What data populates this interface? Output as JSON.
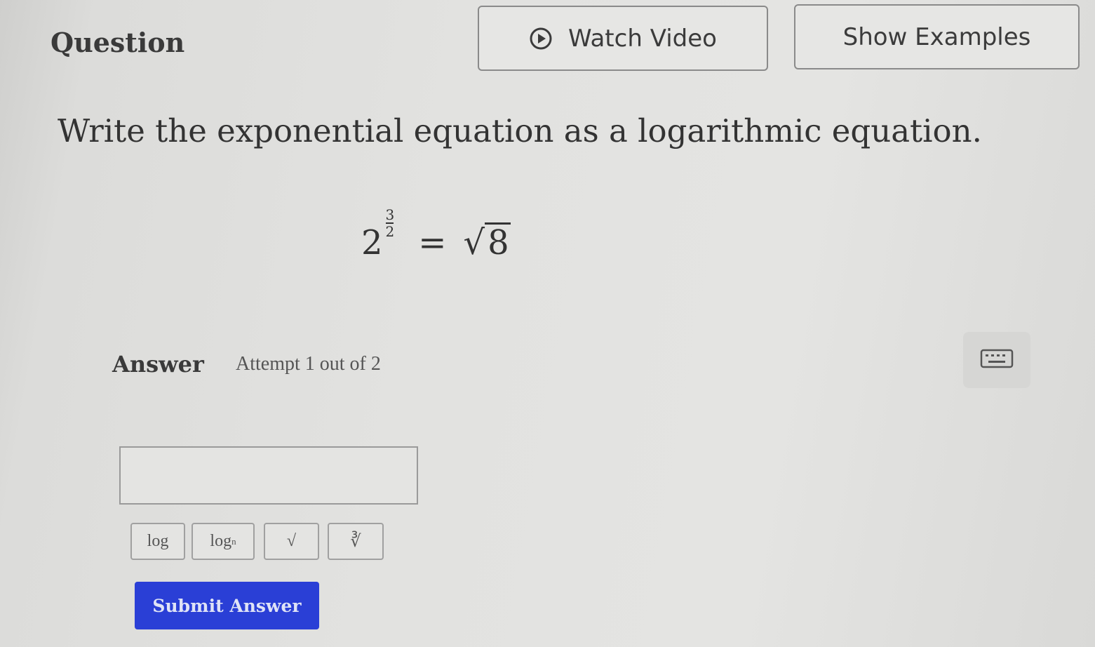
{
  "header": {
    "title": "Question",
    "watch_video_label": "Watch Video",
    "show_examples_label": "Show Examples"
  },
  "question": {
    "prompt": "Write the exponential equation as a logarithmic equation.",
    "equation": {
      "base": "2",
      "exponent_numerator": "3",
      "exponent_denominator": "2",
      "equals": "=",
      "radical_symbol": "√",
      "radicand": "8"
    }
  },
  "answer": {
    "label": "Answer",
    "attempt": "Attempt 1 out of 2",
    "input_value": "",
    "input_placeholder": ""
  },
  "tools": {
    "log": "log",
    "logn_main": "log",
    "logn_sub": "n",
    "sqrt": "√",
    "nroot": "∛"
  },
  "submit_label": "Submit Answer",
  "icons": {
    "play": "play-circle-icon",
    "keyboard": "keyboard-icon"
  },
  "colors": {
    "submit_bg": "#2a3fd6",
    "page_bg": "#e2e2e0"
  }
}
